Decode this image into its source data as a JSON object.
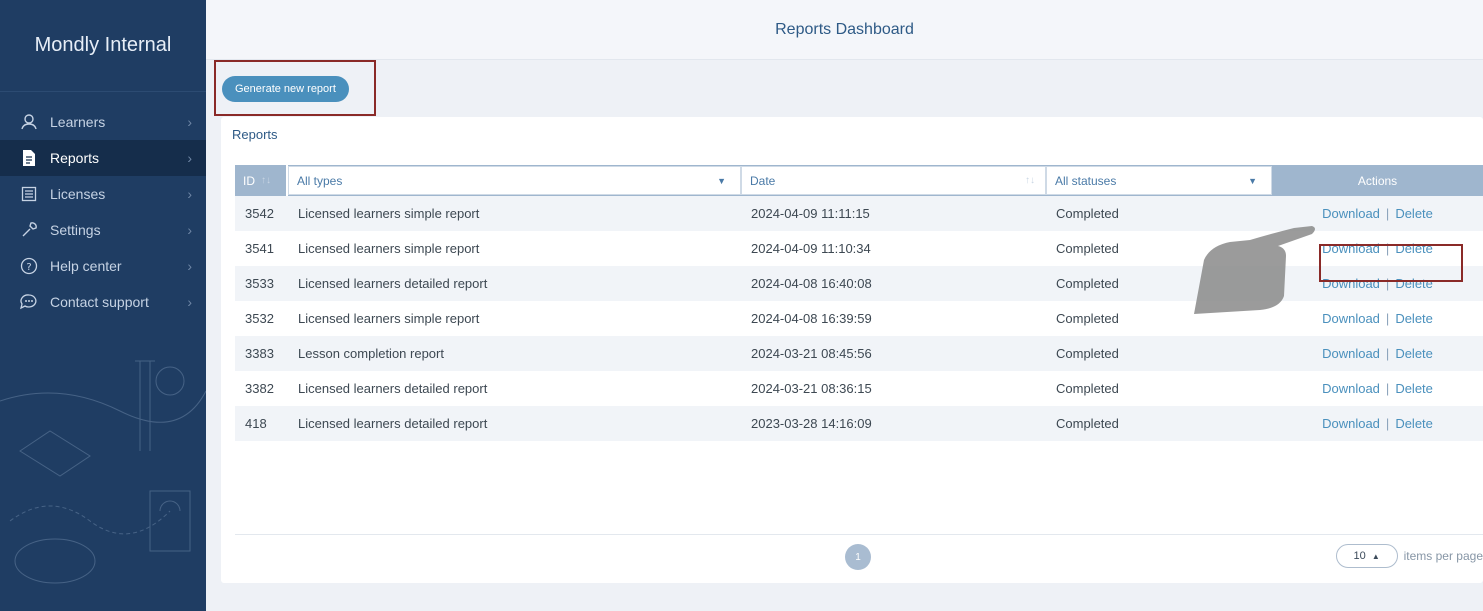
{
  "sidebar": {
    "brand": "Mondly Internal",
    "items": [
      {
        "label": "Learners",
        "icon": "user-icon"
      },
      {
        "label": "Reports",
        "icon": "document-icon",
        "active": true
      },
      {
        "label": "Licenses",
        "icon": "license-icon"
      },
      {
        "label": "Settings",
        "icon": "wrench-icon"
      },
      {
        "label": "Help center",
        "icon": "help-icon"
      },
      {
        "label": "Contact support",
        "icon": "chat-icon"
      }
    ]
  },
  "header": {
    "title": "Reports Dashboard"
  },
  "toolbar": {
    "generate_label": "Generate new report"
  },
  "card": {
    "title": "Reports"
  },
  "table": {
    "columns": {
      "id": "ID",
      "type_filter": "All types",
      "date": "Date",
      "status_filter": "All statuses",
      "actions": "Actions"
    },
    "rows": [
      {
        "id": "3542",
        "type": "Licensed learners simple report",
        "date": "2024-04-09 11:11:15",
        "status": "Completed"
      },
      {
        "id": "3541",
        "type": "Licensed learners simple report",
        "date": "2024-04-09 11:10:34",
        "status": "Completed"
      },
      {
        "id": "3533",
        "type": "Licensed learners detailed report",
        "date": "2024-04-08 16:40:08",
        "status": "Completed"
      },
      {
        "id": "3532",
        "type": "Licensed learners simple report",
        "date": "2024-04-08 16:39:59",
        "status": "Completed"
      },
      {
        "id": "3383",
        "type": "Lesson completion report",
        "date": "2024-03-21 08:45:56",
        "status": "Completed"
      },
      {
        "id": "3382",
        "type": "Licensed learners detailed report",
        "date": "2024-03-21 08:36:15",
        "status": "Completed"
      },
      {
        "id": "418",
        "type": "Licensed learners detailed report",
        "date": "2023-03-28 14:16:09",
        "status": "Completed"
      }
    ],
    "download_label": "Download",
    "separator": "|",
    "delete_label": "Delete"
  },
  "pagination": {
    "current_page": "1",
    "per_page": "10",
    "per_page_label": "items per page"
  },
  "colors": {
    "sidebar": "#1f3d63",
    "accent": "#4a90bd",
    "highlight": "#8a2a28"
  }
}
